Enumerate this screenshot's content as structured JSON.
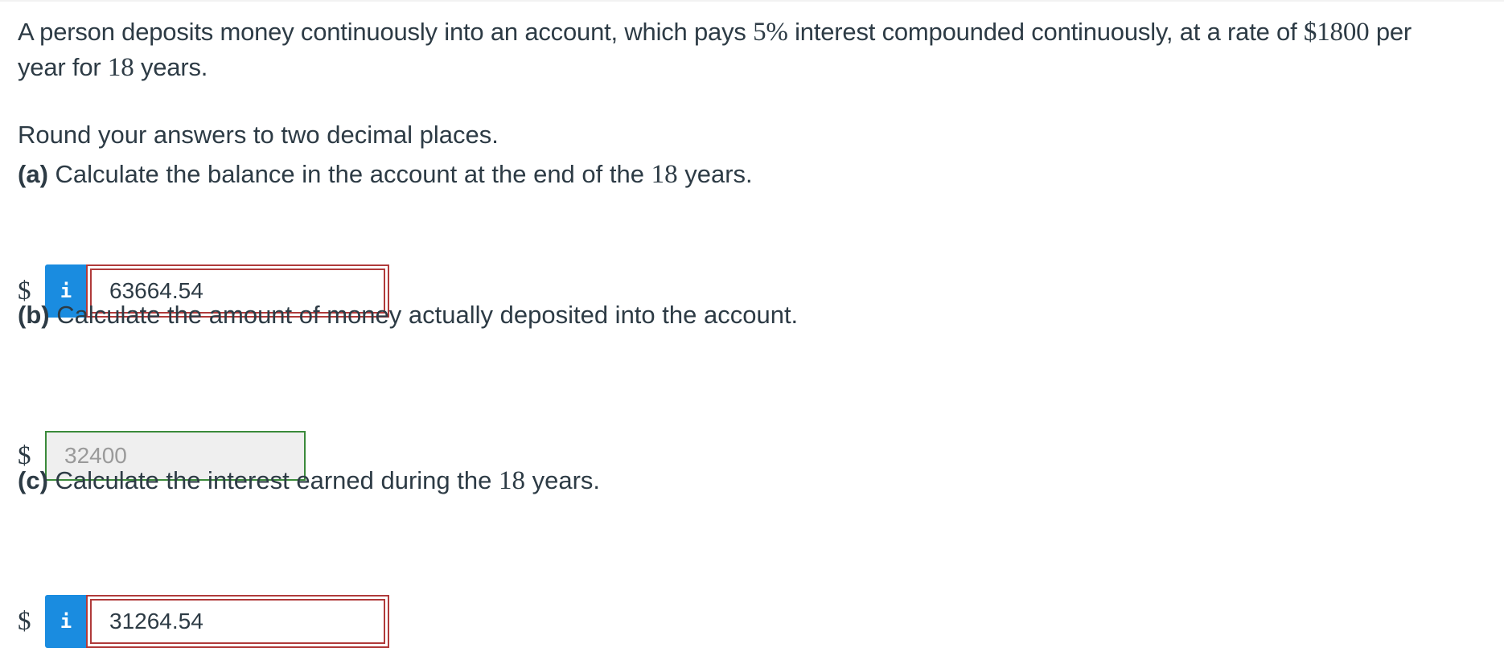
{
  "problem": {
    "text_1": "A person deposits money continuously into an account, which pays ",
    "rate": "5%",
    "text_2": " interest compounded continuously, at a rate of ",
    "amount": "$1800",
    "text_3": " per",
    "text_4": "year for ",
    "years": "18",
    "text_5": " years."
  },
  "instructions": "Round your answers to two decimal places.",
  "parts": {
    "a": {
      "label": "(a)",
      "text_1": " Calculate the balance in the account at the end of the ",
      "years": "18",
      "text_2": " years.",
      "currency": "$",
      "info_icon": "i",
      "answer": "63664.54",
      "status": "incorrect",
      "status_color": "#b03a3a"
    },
    "b": {
      "label": "(b)",
      "text_1": " Calculate the amount of money actually deposited into the account.",
      "currency": "$",
      "answer": "32400",
      "status": "correct",
      "status_color": "#3b8a3b"
    },
    "c": {
      "label": "(c)",
      "text_1": " Calculate the interest earned during the ",
      "years": "18",
      "text_2": " years.",
      "currency": "$",
      "info_icon": "i",
      "answer": "31264.54",
      "status": "incorrect",
      "status_color": "#b03a3a"
    }
  },
  "colors": {
    "text": "#2d3b45",
    "info_button": "#1a8ce0",
    "incorrect_border": "#b03a3a",
    "correct_border": "#3b8a3b",
    "disabled_bg": "#efefef"
  }
}
